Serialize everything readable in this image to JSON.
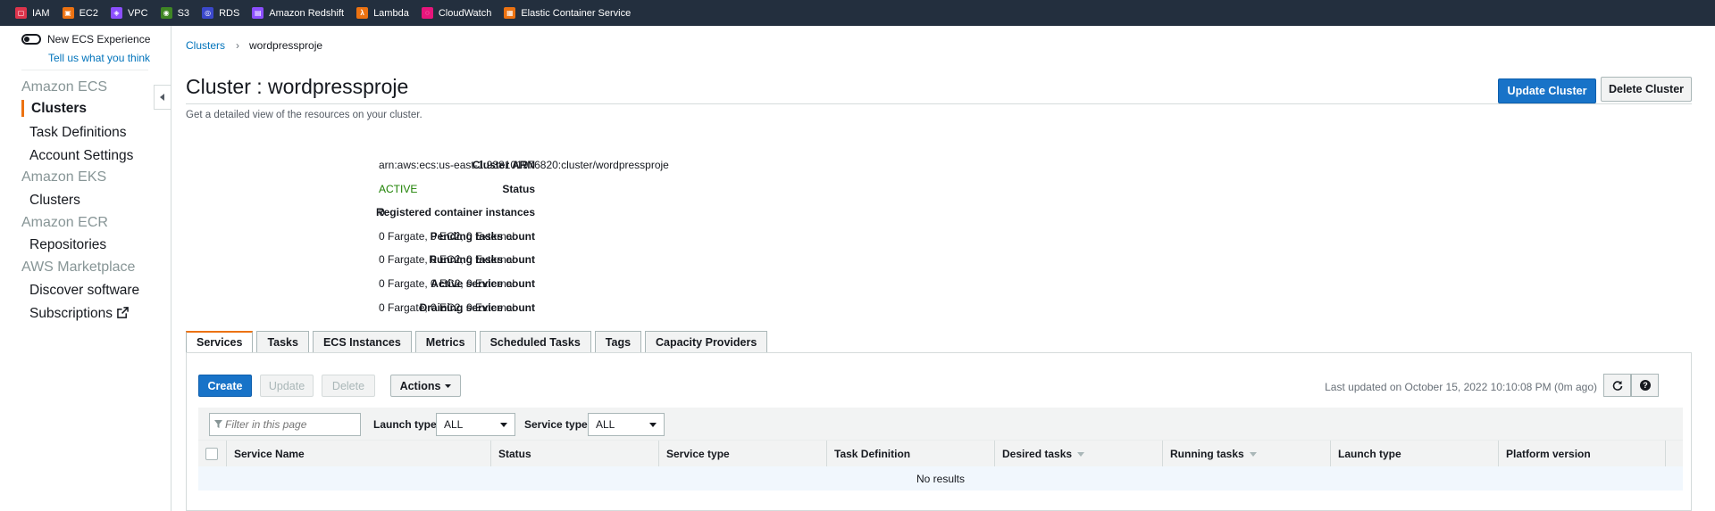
{
  "favorites": [
    {
      "label": "IAM",
      "color": "#dd344c",
      "icon": "iam-icon"
    },
    {
      "label": "EC2",
      "color": "#ec7211",
      "icon": "ec2-icon"
    },
    {
      "label": "VPC",
      "color": "#8c4fff",
      "icon": "vpc-icon"
    },
    {
      "label": "S3",
      "color": "#3f8624",
      "icon": "s3-icon"
    },
    {
      "label": "RDS",
      "color": "#3b48cc",
      "icon": "rds-icon"
    },
    {
      "label": "Amazon Redshift",
      "color": "#8c4fff",
      "icon": "redshift-icon"
    },
    {
      "label": "Lambda",
      "color": "#ec7211",
      "icon": "lambda-icon"
    },
    {
      "label": "CloudWatch",
      "color": "#e7157b",
      "icon": "cloudwatch-icon"
    },
    {
      "label": "Elastic Container Service",
      "color": "#ec7211",
      "icon": "ecs-icon"
    }
  ],
  "sidebar": {
    "toggle_label": "New ECS Experience",
    "tell_link": "Tell us what you think",
    "groups": {
      "ecs": "Amazon ECS",
      "eks": "Amazon EKS",
      "ecr": "Amazon ECR",
      "marketplace": "AWS Marketplace"
    },
    "items": {
      "clusters": "Clusters",
      "task_definitions": "Task Definitions",
      "account_settings": "Account Settings",
      "eks_clusters": "Clusters",
      "repositories": "Repositories",
      "discover": "Discover software",
      "subscriptions": "Subscriptions"
    }
  },
  "breadcrumb": {
    "root": "Clusters",
    "sep": "›",
    "current": "wordpressproje"
  },
  "page": {
    "title": "Cluster : wordpressproje",
    "subtitle": "Get a detailed view of the resources on your cluster.",
    "update_button": "Update Cluster",
    "delete_button": "Delete Cluster"
  },
  "details": [
    {
      "label": "Cluster ARN",
      "value": "arn:aws:ecs:us-east-1:938101976820:cluster/wordpressproje"
    },
    {
      "label": "Status",
      "value": "ACTIVE"
    },
    {
      "label": "Registered container instances",
      "value": "0"
    },
    {
      "label": "Pending tasks count",
      "value": "0 Fargate, 0 EC2, 0 External"
    },
    {
      "label": "Running tasks count",
      "value": "0 Fargate, 0 EC2, 0 External"
    },
    {
      "label": "Active service count",
      "value": "0 Fargate, 0 EC2, 0 External"
    },
    {
      "label": "Draining service count",
      "value": "0 Fargate, 0 EC2, 0 External"
    }
  ],
  "tabs": [
    "Services",
    "Tasks",
    "ECS Instances",
    "Metrics",
    "Scheduled Tasks",
    "Tags",
    "Capacity Providers"
  ],
  "services": {
    "create": "Create",
    "update": "Update",
    "delete": "Delete",
    "actions": "Actions",
    "last_updated": "Last updated on October 15, 2022 10:10:08 PM (0m ago)",
    "filter_placeholder": "Filter in this page",
    "launch_type_label": "Launch type",
    "launch_type_value": "ALL",
    "service_type_label": "Service type",
    "service_type_value": "ALL",
    "columns": [
      "Service Name",
      "Status",
      "Service type",
      "Task Definition",
      "Desired tasks",
      "Running tasks",
      "Launch type",
      "Platform version"
    ],
    "empty": "No results"
  }
}
